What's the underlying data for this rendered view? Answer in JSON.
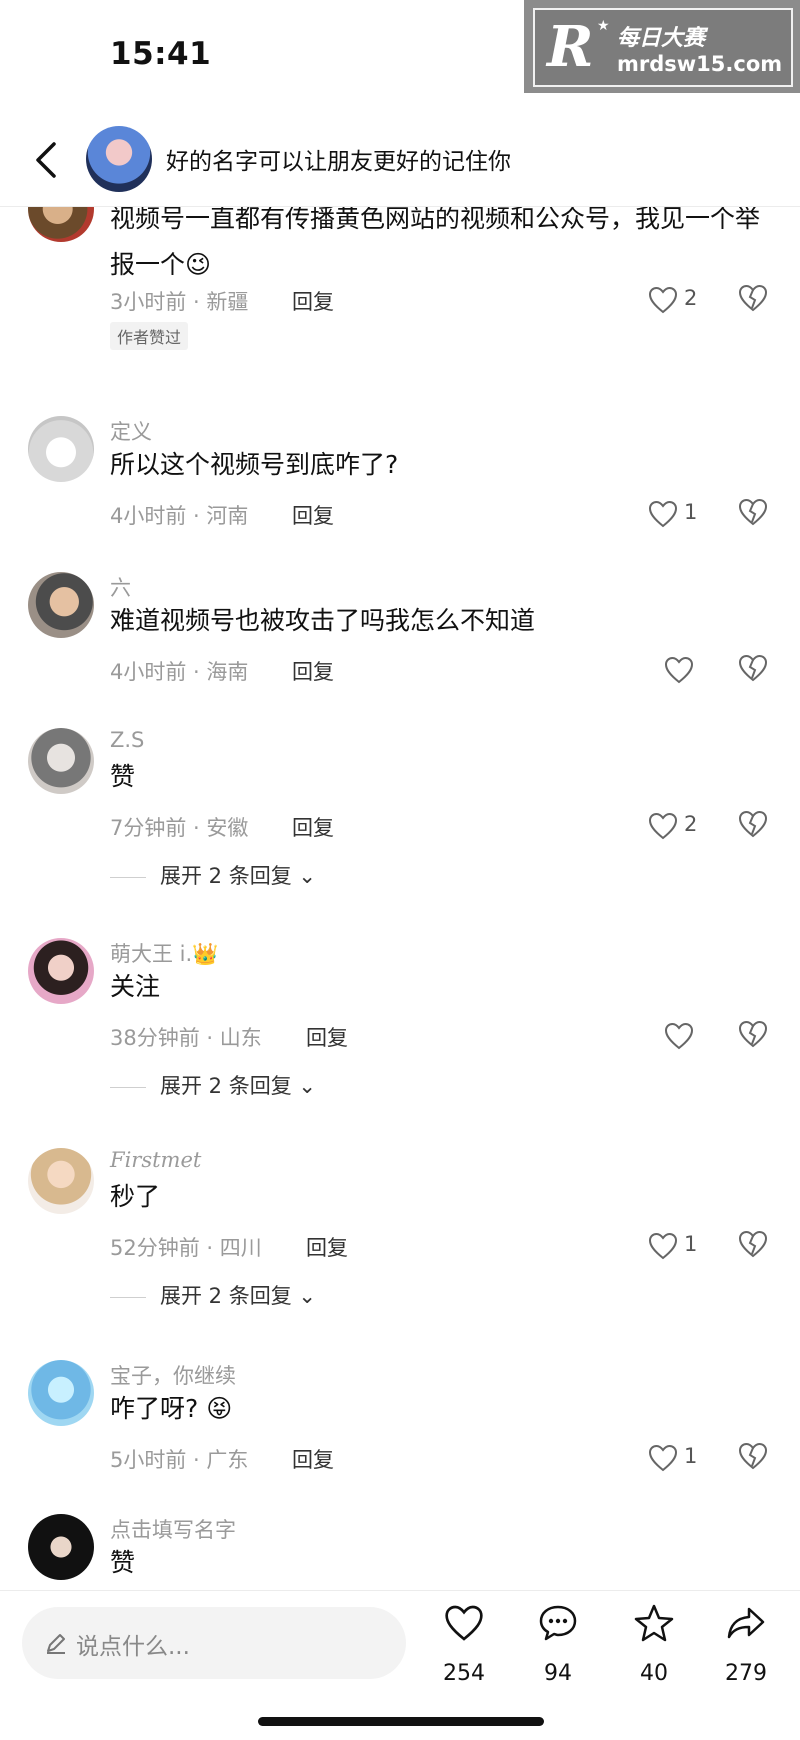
{
  "status_bar": {
    "time": "15:41"
  },
  "watermark": {
    "logo": "R",
    "title": "每日大赛",
    "url": "mrdsw15.com"
  },
  "header": {
    "title": "好的名字可以让朋友更好的记住你"
  },
  "comments": [
    {
      "username": "",
      "content": "视频号一直都有传播黄色网站的视频和公众号，我见一个举报一个😉",
      "time_location": "3小时前 · 新疆",
      "reply": "回复",
      "likes": "2",
      "badge": "作者赞过"
    },
    {
      "username": "定义",
      "content": "所以这个视频号到底咋了?",
      "time_location": "4小时前 · 河南",
      "reply": "回复",
      "likes": "1"
    },
    {
      "username": "六",
      "content": "难道视频号也被攻击了吗我怎么不知道",
      "time_location": "4小时前 · 海南",
      "reply": "回复",
      "likes": ""
    },
    {
      "username": "Z.S",
      "content": "赞",
      "time_location": "7分钟前 · 安徽",
      "reply": "回复",
      "likes": "2",
      "expand": "展开 2 条回复"
    },
    {
      "username": "萌大王 i.👑",
      "content": "关注",
      "time_location": "38分钟前 · 山东",
      "reply": "回复",
      "likes": "",
      "expand": "展开 2 条回复"
    },
    {
      "username": "Firstmet",
      "content": "秒了",
      "time_location": "52分钟前 · 四川",
      "reply": "回复",
      "likes": "1",
      "expand": "展开 2 条回复"
    },
    {
      "username": "宝子，你继续",
      "content": "咋了呀? 😝",
      "time_location": "5小时前 · 广东",
      "reply": "回复",
      "likes": "1"
    },
    {
      "username": "点击填写名字",
      "content": "赞"
    }
  ],
  "bottom_bar": {
    "input_placeholder": "说点什么...",
    "likes": "254",
    "comments": "94",
    "favorites": "40",
    "shares": "279"
  }
}
